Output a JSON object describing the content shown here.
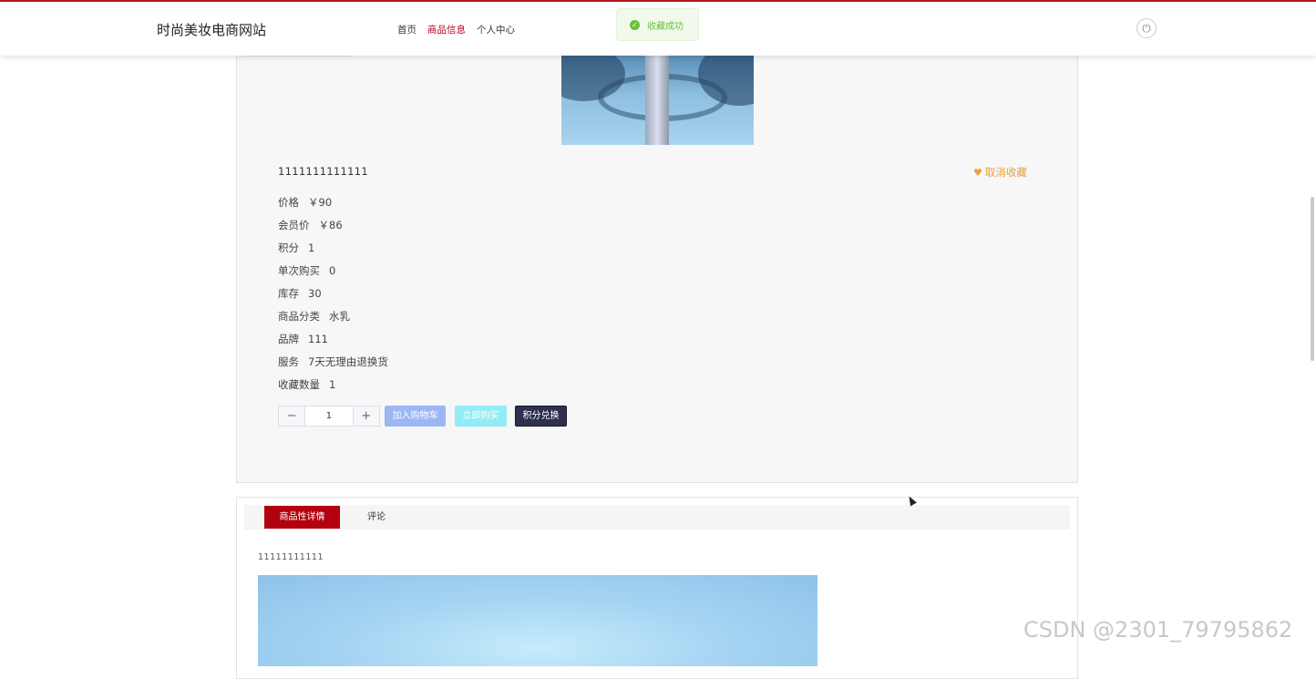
{
  "header": {
    "brand": "时尚美妆电商网站",
    "nav": [
      "首页",
      "商品信息",
      "个人中心"
    ],
    "active_nav": "商品信息",
    "power_icon": "power-icon"
  },
  "toast": {
    "message": "收藏成功",
    "color": "#67c23a"
  },
  "product": {
    "name": "1111111111111",
    "favorite_label": "取消收藏",
    "attributes": [
      {
        "label": "价格",
        "value": "￥90"
      },
      {
        "label": "会员价",
        "value": "￥86"
      },
      {
        "label": "积分",
        "value": "1"
      },
      {
        "label": "单次购买",
        "value": "0"
      },
      {
        "label": "库存",
        "value": "30"
      },
      {
        "label": "商品分类",
        "value": "水乳"
      },
      {
        "label": "品牌",
        "value": "111"
      },
      {
        "label": "服务",
        "value": "7天无理由退换货"
      },
      {
        "label": "收藏数量",
        "value": "1"
      }
    ],
    "quantity": "1",
    "minus": "−",
    "plus": "+",
    "add_to_cart": "加入购物车",
    "buy_now": "立即购买",
    "points_exchange": "积分兑换"
  },
  "detail": {
    "tabs": [
      "商品性详情",
      "评论"
    ],
    "active_tab": "商品性详情",
    "description": "11111111111"
  },
  "watermark": "CSDN @2301_79795862",
  "colors": {
    "brand_red": "#b3000e",
    "favorite": "#e6a23c",
    "success": "#67c23a"
  }
}
